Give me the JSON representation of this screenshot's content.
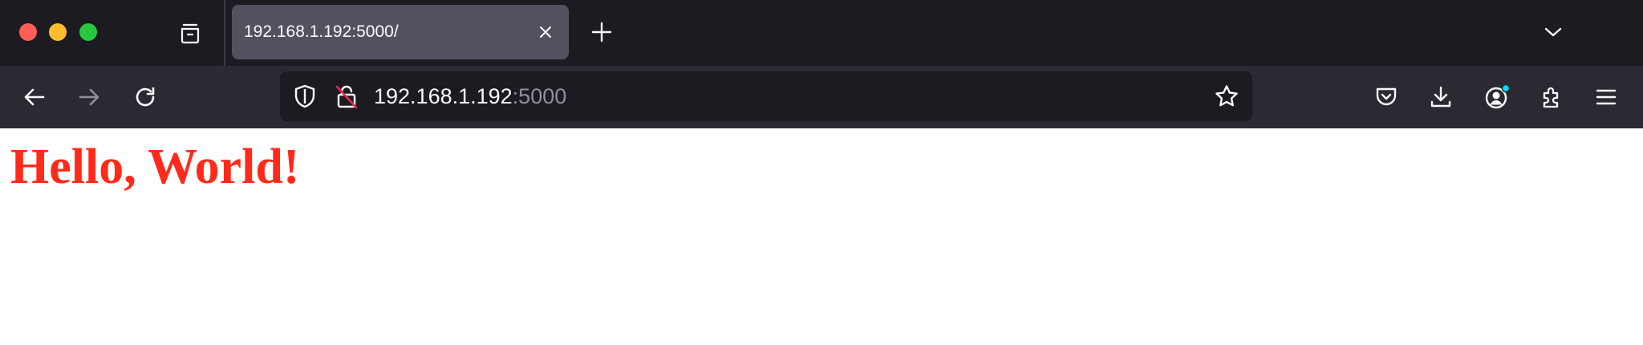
{
  "window": {
    "controls": [
      "close",
      "minimize",
      "maximize"
    ]
  },
  "tabs": [
    {
      "title": "192.168.1.192:5000/",
      "active": true
    }
  ],
  "toolbar": {
    "back_icon": "arrow-left-icon",
    "forward_icon": "arrow-right-icon",
    "reload_icon": "reload-icon",
    "right_icons": [
      "pocket-icon",
      "download-icon",
      "account-icon",
      "extensions-icon",
      "menu-icon"
    ]
  },
  "urlbar": {
    "host": "192.168.1.192",
    "port": ":5000"
  },
  "page": {
    "heading": "Hello, World!"
  },
  "colors": {
    "titlebar_bg": "#1c1b22",
    "tab_active_bg": "#52525e",
    "navbar_bg": "#2b2a33",
    "urlbar_bg": "#1c1b22",
    "heading_color": "#ff2a1a",
    "notification_dot": "#00ddff"
  }
}
